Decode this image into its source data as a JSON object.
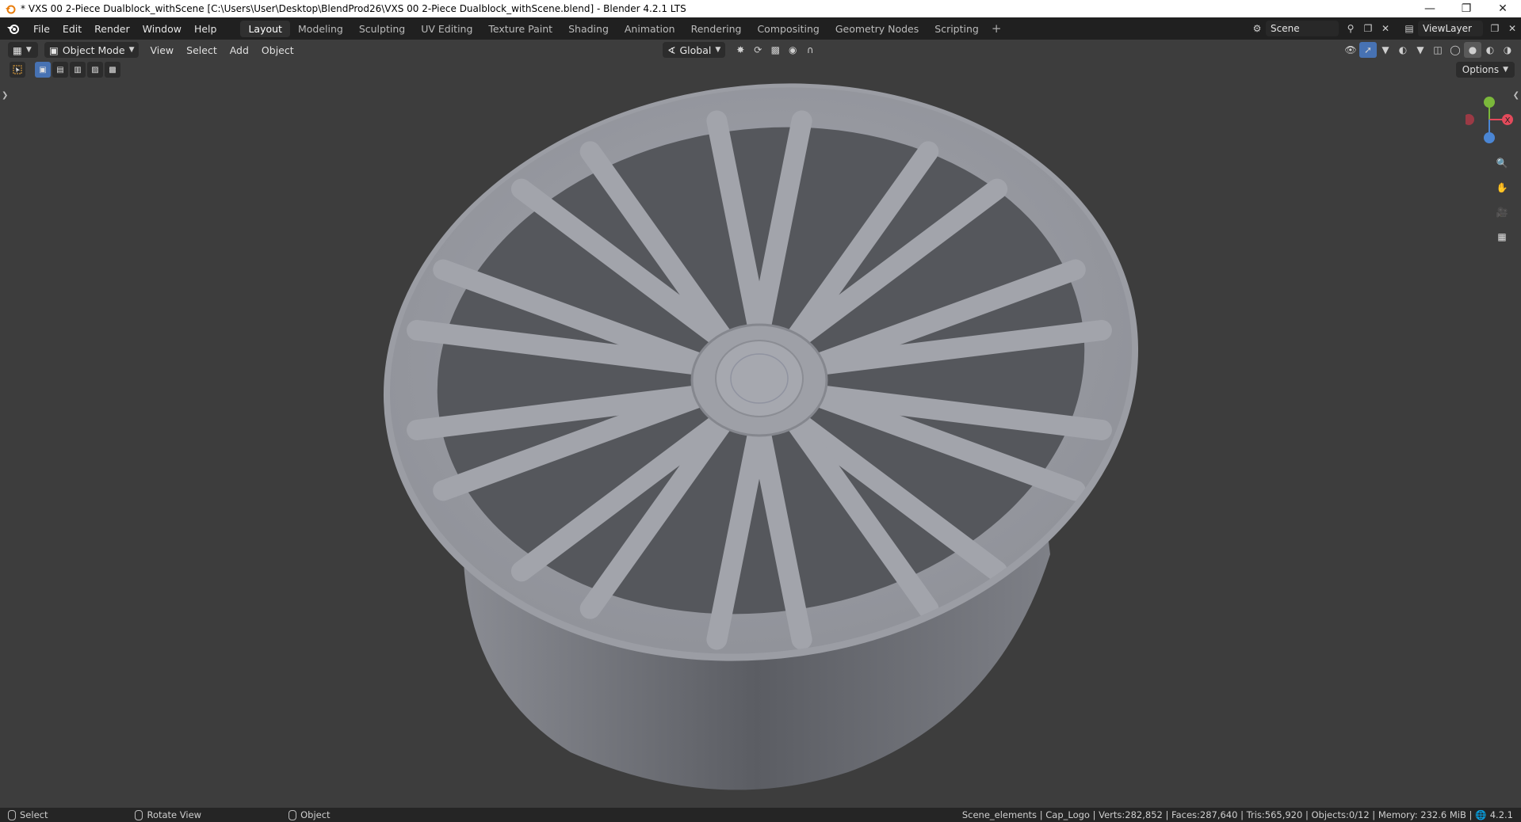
{
  "window": {
    "title": "* VXS 00 2-Piece Dualblock_withScene [C:\\Users\\User\\Desktop\\BlendProd26\\VXS 00 2-Piece Dualblock_withScene.blend] - Blender 4.2.1 LTS",
    "controls": [
      "minimize",
      "restore",
      "close"
    ]
  },
  "menu": [
    "File",
    "Edit",
    "Render",
    "Window",
    "Help"
  ],
  "workspace_tabs": [
    {
      "label": "Layout",
      "active": true
    },
    {
      "label": "Modeling"
    },
    {
      "label": "Sculpting"
    },
    {
      "label": "UV Editing"
    },
    {
      "label": "Texture Paint"
    },
    {
      "label": "Shading"
    },
    {
      "label": "Animation"
    },
    {
      "label": "Rendering"
    },
    {
      "label": "Compositing"
    },
    {
      "label": "Geometry Nodes"
    },
    {
      "label": "Scripting"
    }
  ],
  "scene": {
    "name": "Scene",
    "view_layer": "ViewLayer"
  },
  "viewport_header": {
    "mode": "Object Mode",
    "menus": [
      "View",
      "Select",
      "Add",
      "Object"
    ],
    "orientation": "Global",
    "options_label": "Options"
  },
  "status_bar": {
    "left": [
      {
        "label": "Select"
      },
      {
        "label": "Rotate View"
      },
      {
        "label": "Object"
      }
    ],
    "stats": "Scene_elements | Cap_Logo | Verts:282,852 | Faces:287,640 | Tris:565,920 | Objects:0/12 | Memory: 232.6 MiB | ",
    "version": "4.2.1"
  },
  "gizmo": {
    "axis_x_label": "X",
    "colors": {
      "x": "#e34a5b",
      "y": "#7bb83b",
      "z": "#4b86d4"
    }
  },
  "colors": {
    "viewport_bg": "#3d3d3d",
    "accent": "#4772b3",
    "wheel": "#9c9ea6"
  }
}
